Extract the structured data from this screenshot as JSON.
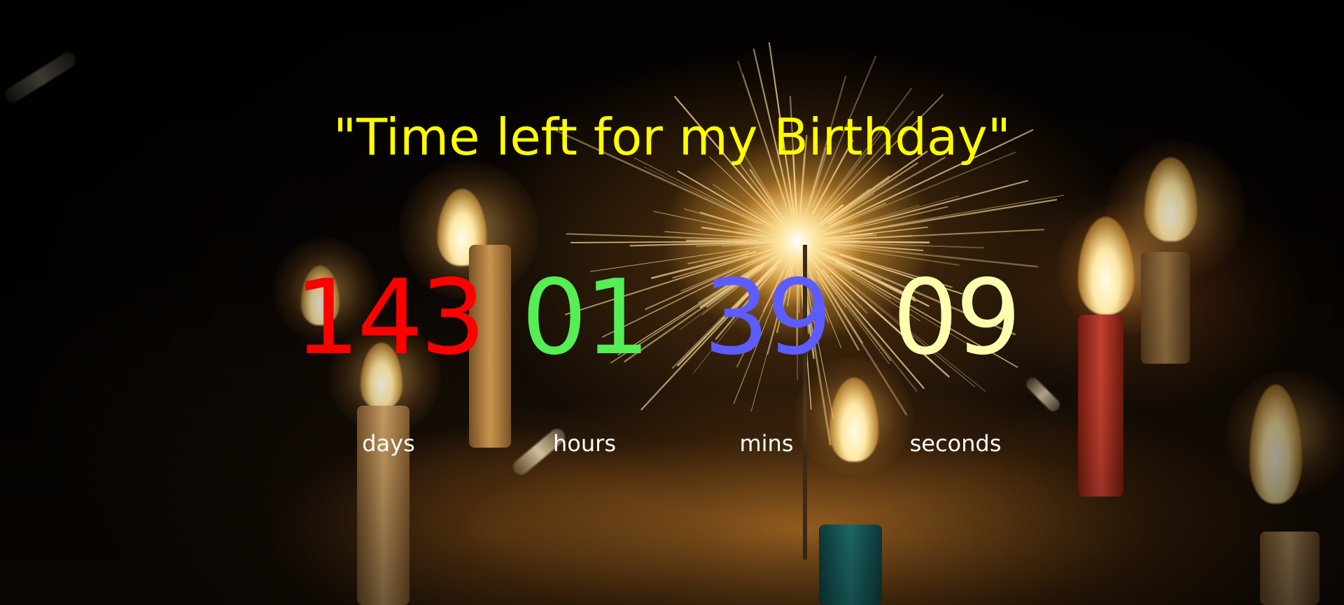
{
  "page": {
    "title": "\"Time left for my Birthday\""
  },
  "countdown": {
    "units": [
      {
        "key": "days",
        "value": "143",
        "label": "days",
        "color": "#ff0000"
      },
      {
        "key": "hours",
        "value": "01",
        "label": "hours",
        "color": "#55ee55"
      },
      {
        "key": "mins",
        "value": "39",
        "label": "mins",
        "color": "#5c5cff"
      },
      {
        "key": "seconds",
        "value": "09",
        "label": "seconds",
        "color": "#ffffb0"
      }
    ]
  },
  "theme": {
    "title_color": "#ffff00",
    "label_color": "#ffffff",
    "background_description_icon": "sparkler-candles-photo"
  }
}
